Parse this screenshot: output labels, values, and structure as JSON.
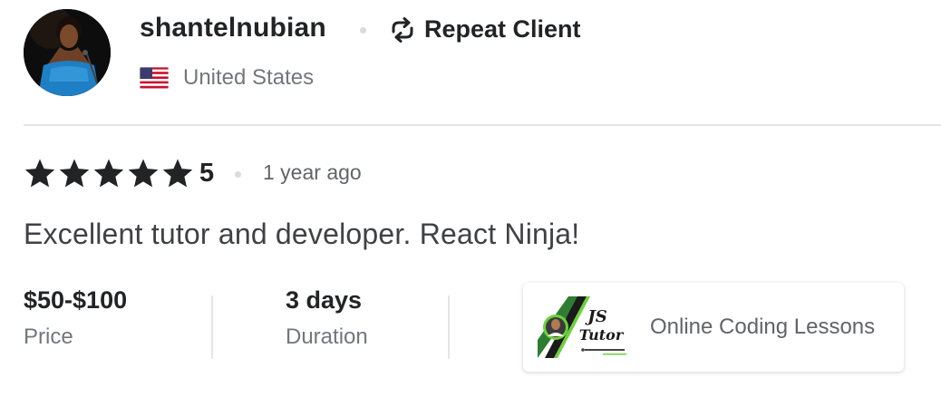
{
  "reviewer": {
    "username": "shantelnubian",
    "badge_label": "Repeat Client",
    "badge_icon": "repeat-icon",
    "country": "United States",
    "flag_icon": "us-flag-icon"
  },
  "review": {
    "stars": 5,
    "rating": "5",
    "time_ago": "1 year ago",
    "text": "Excellent tutor and developer. React Ninja!"
  },
  "stats": {
    "price": {
      "value": "$50-$100",
      "label": "Price"
    },
    "duration": {
      "value": "3 days",
      "label": "Duration"
    }
  },
  "gig": {
    "title": "Online Coding Lessons",
    "thumb_text": "JS Tutor",
    "thumb_colors": {
      "green": "#2e7d32",
      "bright_green": "#6bd23a",
      "dark": "#1b1b1b"
    }
  },
  "colors": {
    "text_dark": "#222325",
    "text_muted": "#74767e",
    "divider": "#e4e5e7"
  }
}
